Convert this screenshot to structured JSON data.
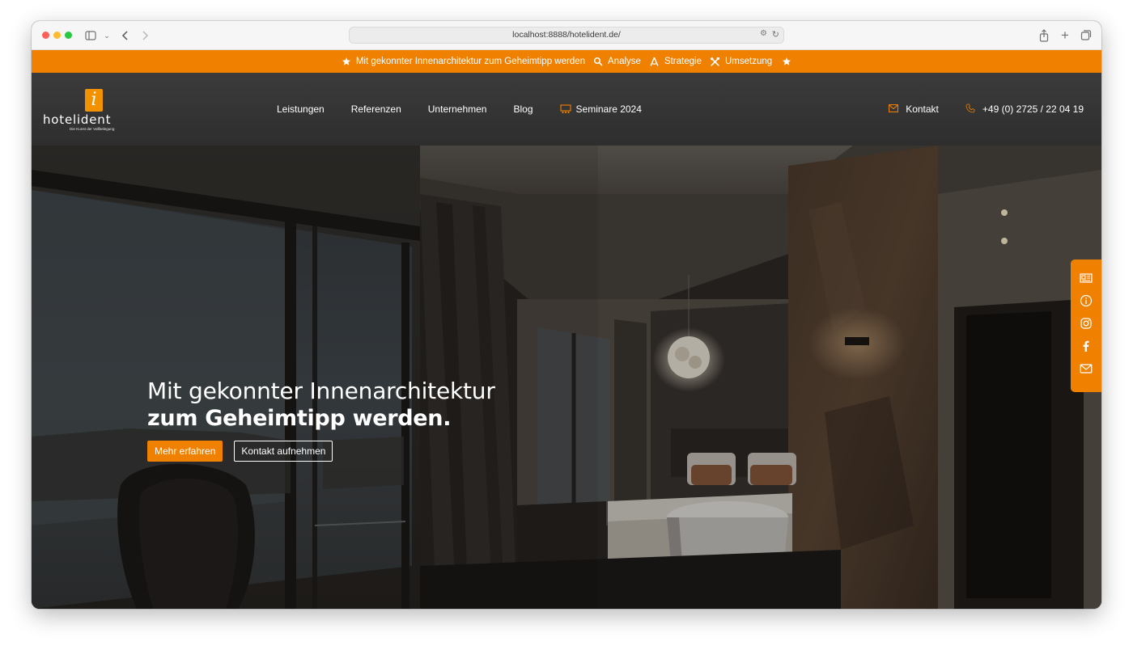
{
  "browser": {
    "url": "localhost:8888/hotelident.de/"
  },
  "topbar": {
    "tagline": "Mit gekonnter Innenarchitektur zum Geheimtipp werden",
    "items": [
      {
        "icon": "search-icon",
        "label": "Analyse"
      },
      {
        "icon": "compass-icon",
        "label": "Strategie"
      },
      {
        "icon": "tools-icon",
        "label": "Umsetzung"
      }
    ]
  },
  "logo": {
    "mark": "i",
    "name": "hotelident",
    "tagline": "Die Kunst der Vollbelegung"
  },
  "nav": {
    "items": [
      "Leistungen",
      "Referenzen",
      "Unternehmen",
      "Blog"
    ],
    "seminare": "Seminare 2024"
  },
  "contact": {
    "kontakt": "Kontakt",
    "phone": "+49 (0) 2725 / 22 04 19"
  },
  "hero": {
    "line1": "Mit gekonnter Innenarchitektur",
    "line2": "zum Geheimtipp werden.",
    "primary_button": "Mehr erfahren",
    "secondary_button": "Kontakt aufnehmen"
  },
  "side_bar": {
    "icons": [
      "newspaper-icon",
      "info-icon",
      "instagram-icon",
      "facebook-icon",
      "mail-icon"
    ]
  },
  "colors": {
    "accent": "#f08000",
    "header": "#333333"
  }
}
